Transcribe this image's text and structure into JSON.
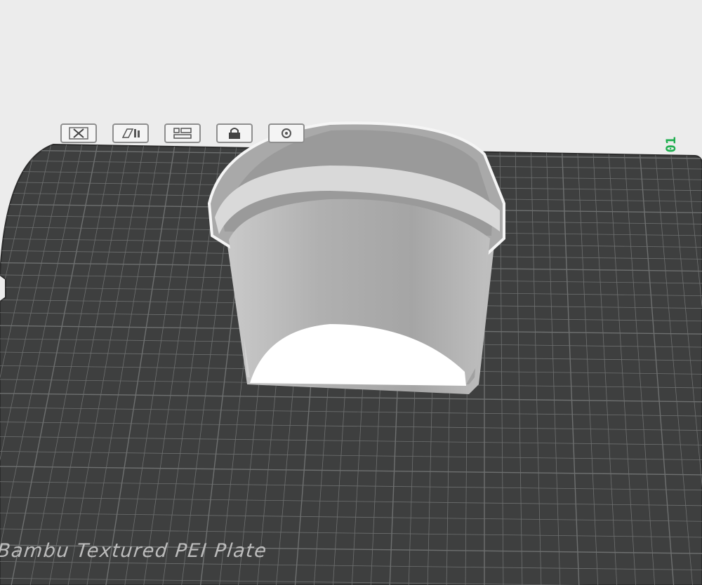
{
  "plate": {
    "number": "01",
    "label": "Bambu Textured PEI Plate"
  },
  "toolbar": {
    "buttons": [
      {
        "name": "delete-plate",
        "icon": "close-x-icon"
      },
      {
        "name": "auto-orient",
        "icon": "orient-icon"
      },
      {
        "name": "arrange",
        "icon": "arrange-icon"
      },
      {
        "name": "lock-plate",
        "icon": "lock-icon"
      },
      {
        "name": "plate-settings",
        "icon": "settings-icon"
      }
    ]
  },
  "colors": {
    "background": "#ececec",
    "bed": "#3e3f3f",
    "grid": "#6e7070",
    "model": "#c8c8c8",
    "plate_number": "#1fae4f"
  }
}
